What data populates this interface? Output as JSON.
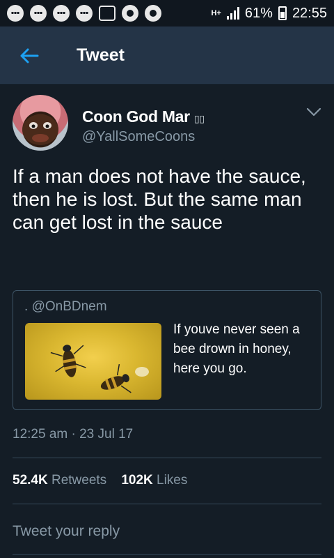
{
  "status_bar": {
    "battery": "61%",
    "time": "22:55",
    "network": "H+"
  },
  "app_bar": {
    "title": "Tweet",
    "back_icon": "arrow-left-icon"
  },
  "tweet": {
    "name": "Coon God Mar",
    "name_emoji": "▯▯",
    "handle": "@YallSomeCoons",
    "text": "If a man does not have the sauce, then he is lost. But the same man can get lost in the sauce",
    "quote": {
      "handle": "@OnBDnem",
      "prefix": ".",
      "text": "If youve never seen a bee drown in honey, here you go."
    },
    "timestamp": "12:25 am · 23 Jul 17",
    "retweets_count": "52.4K",
    "retweets_label": "Retweets",
    "likes_count": "102K",
    "likes_label": "Likes"
  },
  "reply": {
    "placeholder": "Tweet your reply"
  },
  "colors": {
    "background": "#141d26",
    "app_bar": "#243447",
    "accent": "#1da1f2",
    "secondary_text": "#8899a6"
  }
}
